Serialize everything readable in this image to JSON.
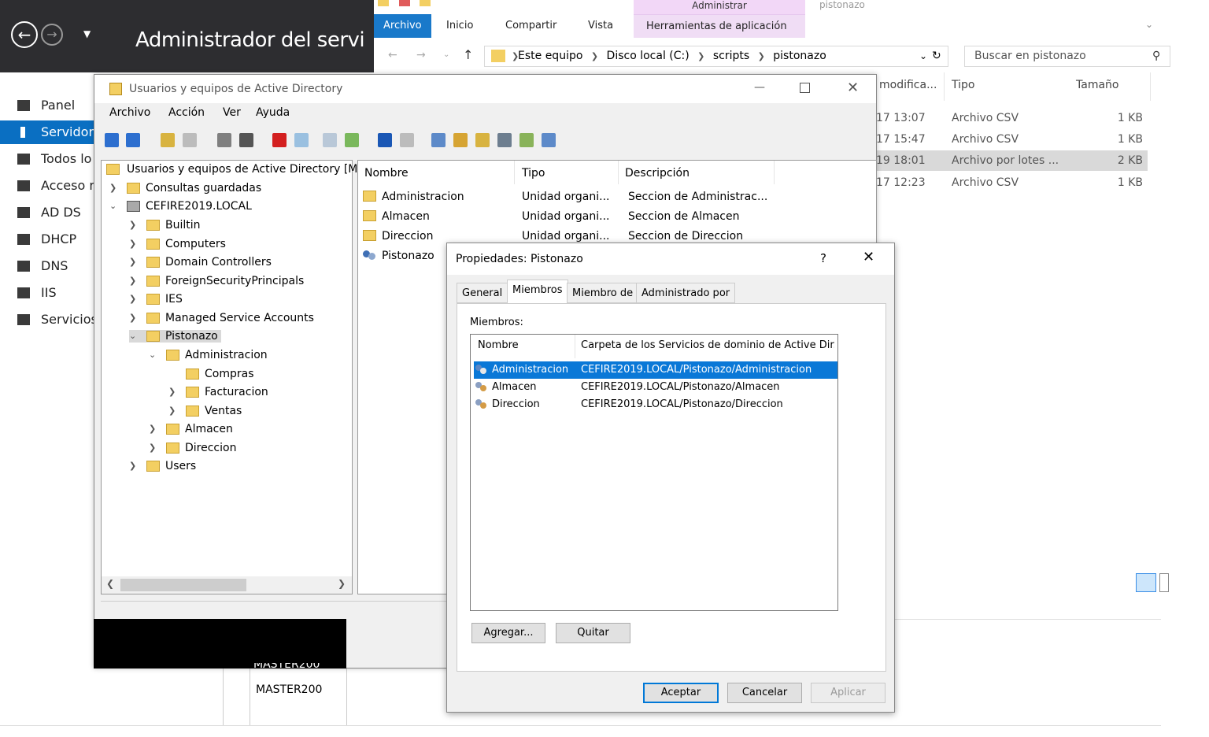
{
  "server_manager": {
    "title": "Administrador del servi",
    "sidebar": [
      {
        "label": "Panel"
      },
      {
        "label": "Servidor"
      },
      {
        "label": "Todos lo"
      },
      {
        "label": "Acceso r"
      },
      {
        "label": "AD DS"
      },
      {
        "label": "DHCP"
      },
      {
        "label": "DNS"
      },
      {
        "label": "IIS"
      },
      {
        "label": "Servicios"
      }
    ],
    "bottom_items": [
      "MASTER200",
      "MASTER200"
    ]
  },
  "explorer": {
    "ribbon_context": "Administrar",
    "window_title_partial": "pistonazo",
    "tabs": {
      "archivo": "Archivo",
      "inicio": "Inicio",
      "compartir": "Compartir",
      "vista": "Vista",
      "herramientas": "Herramientas de aplicación"
    },
    "breadcrumb": [
      "Este equipo",
      "Disco local (C:)",
      "scripts",
      "pistonazo"
    ],
    "search_placeholder": "Buscar en pistonazo",
    "columns": {
      "modified": "modifica...",
      "type": "Tipo",
      "size": "Tamaño"
    },
    "files": [
      {
        "modified": "17 13:07",
        "type": "Archivo CSV",
        "size": "1 KB"
      },
      {
        "modified": "17 15:47",
        "type": "Archivo CSV",
        "size": "1 KB"
      },
      {
        "modified": "19 18:01",
        "type": "Archivo por lotes ...",
        "size": "2 KB"
      },
      {
        "modified": "17 12:23",
        "type": "Archivo CSV",
        "size": "1 KB"
      }
    ]
  },
  "ad_window": {
    "title": "Usuarios y equipos de Active Directory",
    "menu": [
      "Archivo",
      "Acción",
      "Ver",
      "Ayuda"
    ],
    "tree": [
      {
        "label": "Usuarios y equipos de Active Directory [M"
      },
      {
        "label": "Consultas guardadas"
      },
      {
        "label": "CEFIRE2019.LOCAL"
      },
      {
        "label": "Builtin"
      },
      {
        "label": "Computers"
      },
      {
        "label": "Domain Controllers"
      },
      {
        "label": "ForeignSecurityPrincipals"
      },
      {
        "label": "IES"
      },
      {
        "label": "Managed Service Accounts"
      },
      {
        "label": "Pistonazo"
      },
      {
        "label": "Administracion"
      },
      {
        "label": "Compras"
      },
      {
        "label": "Facturacion"
      },
      {
        "label": "Ventas"
      },
      {
        "label": "Almacen"
      },
      {
        "label": "Direccion"
      },
      {
        "label": "Users"
      }
    ],
    "list_headers": {
      "name": "Nombre",
      "type": "Tipo",
      "desc": "Descripción"
    },
    "list": [
      {
        "name": "Administracion",
        "type": "Unidad organi...",
        "desc": "Seccion de Administrac..."
      },
      {
        "name": "Almacen",
        "type": "Unidad organi...",
        "desc": "Seccion de Almacen"
      },
      {
        "name": "Direccion",
        "type": "Unidad organi...",
        "desc": "Seccion de Direccion"
      },
      {
        "name": "Pistonazo",
        "type": "",
        "desc": ""
      }
    ]
  },
  "dialog": {
    "title": "Propiedades: Pistonazo",
    "help": "?",
    "tabs": [
      "General",
      "Miembros",
      "Miembro de",
      "Administrado por"
    ],
    "members_label": "Miembros:",
    "headers": {
      "name": "Nombre",
      "folder": "Carpeta de los Servicios de dominio de Active Dir..."
    },
    "members": [
      {
        "name": "Administracion",
        "folder": "CEFIRE2019.LOCAL/Pistonazo/Administracion"
      },
      {
        "name": "Almacen",
        "folder": "CEFIRE2019.LOCAL/Pistonazo/Almacen"
      },
      {
        "name": "Direccion",
        "folder": "CEFIRE2019.LOCAL/Pistonazo/Direccion"
      }
    ],
    "buttons": {
      "add": "Agregar...",
      "remove": "Quitar",
      "ok": "Aceptar",
      "cancel": "Cancelar",
      "apply": "Aplicar"
    }
  }
}
